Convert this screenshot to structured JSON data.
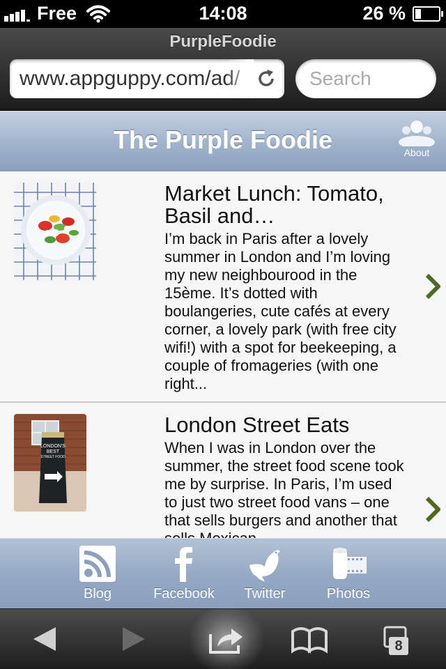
{
  "status_bar": {
    "carrier": "Free",
    "time": "14:08",
    "battery_text": "26 %",
    "battery_level": 0.26
  },
  "browser": {
    "page_title": "PurpleFoodie",
    "url": "www.appguppy.com/ad/",
    "search_placeholder": "Search"
  },
  "app": {
    "title": "The Purple Foodie",
    "about_label": "About"
  },
  "posts": [
    {
      "title": "Market Lunch: Tomato, Basil and…",
      "excerpt": "I’m back in Paris after a lovely summer in London and I’m loving my new neighbourood in the 15ème. It’s dotted with boulangeries, cute cafés at every corner, a lovely park (with free city wifi!) with a spot for beekeeping, a couple of fromageries (with one right..."
    },
    {
      "title": "London Street Eats",
      "excerpt": "When I was in London over the summer, the street food scene took me by surprise. In Paris, I’m used to just two street food vans – one that sells burgers and another that sells Mexican"
    }
  ],
  "thumb2_sign": {
    "line1": "LONDON'S",
    "line2": "BEST",
    "line3": "STREET FOOD"
  },
  "tabs": [
    {
      "label": "Blog",
      "icon": "rss-icon"
    },
    {
      "label": "Facebook",
      "icon": "facebook-icon"
    },
    {
      "label": "Twitter",
      "icon": "twitter-bird-icon"
    },
    {
      "label": "Photos",
      "icon": "film-roll-icon"
    }
  ],
  "toolbar": {
    "open_pages_count": "8"
  },
  "colors": {
    "header_blue": "#9aaec8",
    "chevron_green": "#4f6a23"
  }
}
